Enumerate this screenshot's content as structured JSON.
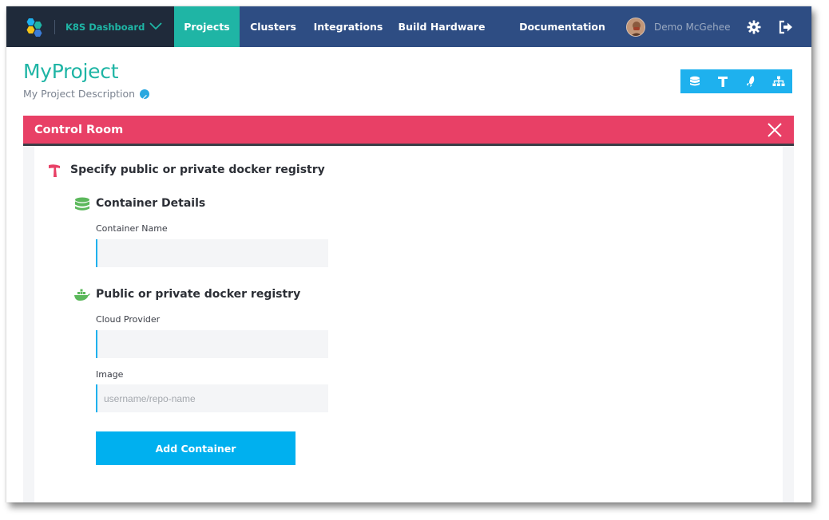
{
  "brand": {
    "name": "K8S Dashboard"
  },
  "nav": {
    "items": [
      {
        "label": "Projects",
        "active": true
      },
      {
        "label": "Clusters",
        "active": false
      },
      {
        "label": "Integrations",
        "active": false
      },
      {
        "label": "Build Hardware",
        "active": false
      },
      {
        "label": "Documentation",
        "active": false
      }
    ]
  },
  "user": {
    "name": "Demo McGehee"
  },
  "icons": {
    "settings": "gear-icon",
    "logout": "logout-icon",
    "toolbar": [
      "database-icon",
      "hammer-icon",
      "rocket-icon",
      "sitemap-icon"
    ]
  },
  "project": {
    "title": "MyProject",
    "description": "My Project Description"
  },
  "panel": {
    "title": "Control Room",
    "step_title": "Specify public or private docker registry",
    "container_section": {
      "title": "Container Details"
    },
    "registry_section": {
      "title": "Public or private docker registry"
    },
    "fields": {
      "container_name": {
        "label": "Container Name",
        "value": "",
        "placeholder": ""
      },
      "cloud_provider": {
        "label": "Cloud Provider",
        "value": "",
        "placeholder": ""
      },
      "image": {
        "label": "Image",
        "value": "",
        "placeholder": "username/repo-name"
      }
    },
    "submit_label": "Add Container"
  },
  "colors": {
    "nav_bg": "#2e4d83",
    "brand_bg": "#1f2a3a",
    "accent_teal": "#1fb5a5",
    "accent_blue": "#1eb1ee",
    "panel_header": "#e84066",
    "button": "#00b0ef"
  }
}
